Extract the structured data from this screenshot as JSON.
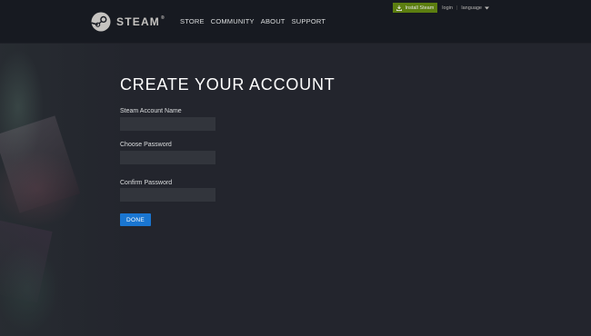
{
  "header": {
    "logo_text": "STEAM",
    "logo_mark": "steam-logo-icon",
    "nav": [
      {
        "label": "STORE"
      },
      {
        "label": "COMMUNITY"
      },
      {
        "label": "ABOUT"
      },
      {
        "label": "SUPPORT"
      }
    ],
    "install_label": "Install Steam",
    "login_label": "login",
    "separator": "|",
    "language_label": "language"
  },
  "form": {
    "title": "CREATE YOUR ACCOUNT",
    "fields": [
      {
        "label": "Steam Account Name",
        "value": ""
      },
      {
        "label": "Choose Password",
        "value": ""
      },
      {
        "label": "Confirm Password",
        "value": ""
      }
    ],
    "submit_label": "DONE"
  },
  "colors": {
    "header_bg": "#171a21",
    "page_bg": "#23252d",
    "install_green": "#5c7e10",
    "done_blue": "#1a76d1",
    "input_bg": "#32353c"
  }
}
